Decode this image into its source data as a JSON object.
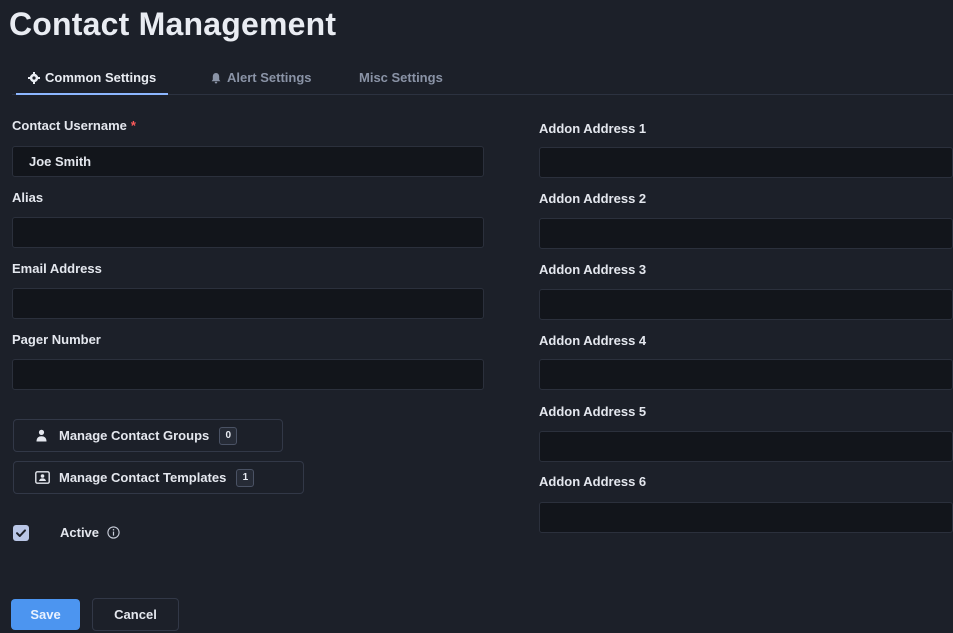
{
  "page": {
    "title": "Contact Management"
  },
  "tabs": [
    {
      "label": "Common Settings",
      "icon": "gear-icon",
      "active": true
    },
    {
      "label": "Alert Settings",
      "icon": "bell-icon",
      "active": false
    },
    {
      "label": "Misc Settings",
      "active": false
    }
  ],
  "form": {
    "username": {
      "label": "Contact Username",
      "required_mark": "*",
      "value": "Joe Smith"
    },
    "alias": {
      "label": "Alias",
      "value": ""
    },
    "email": {
      "label": "Email Address",
      "value": ""
    },
    "pager": {
      "label": "Pager Number",
      "value": ""
    },
    "addons": [
      {
        "label": "Addon Address 1",
        "value": ""
      },
      {
        "label": "Addon Address 2",
        "value": ""
      },
      {
        "label": "Addon Address 3",
        "value": ""
      },
      {
        "label": "Addon Address 4",
        "value": ""
      },
      {
        "label": "Addon Address 5",
        "value": ""
      },
      {
        "label": "Addon Address 6",
        "value": ""
      }
    ],
    "active": {
      "label": "Active",
      "checked": true,
      "info_icon": "info-icon"
    }
  },
  "buttons": {
    "manage_groups": {
      "label": "Manage Contact Groups",
      "count": "0",
      "icon": "user-icon"
    },
    "manage_templates": {
      "label": "Manage Contact Templates",
      "count": "1",
      "icon": "template-icon"
    },
    "save": "Save",
    "cancel": "Cancel"
  },
  "colors": {
    "background": "#1c2029",
    "input_background": "#12151b",
    "accent": "#4c95f0",
    "tab_underline": "#8cb6ff",
    "required": "#ff5a5a"
  }
}
